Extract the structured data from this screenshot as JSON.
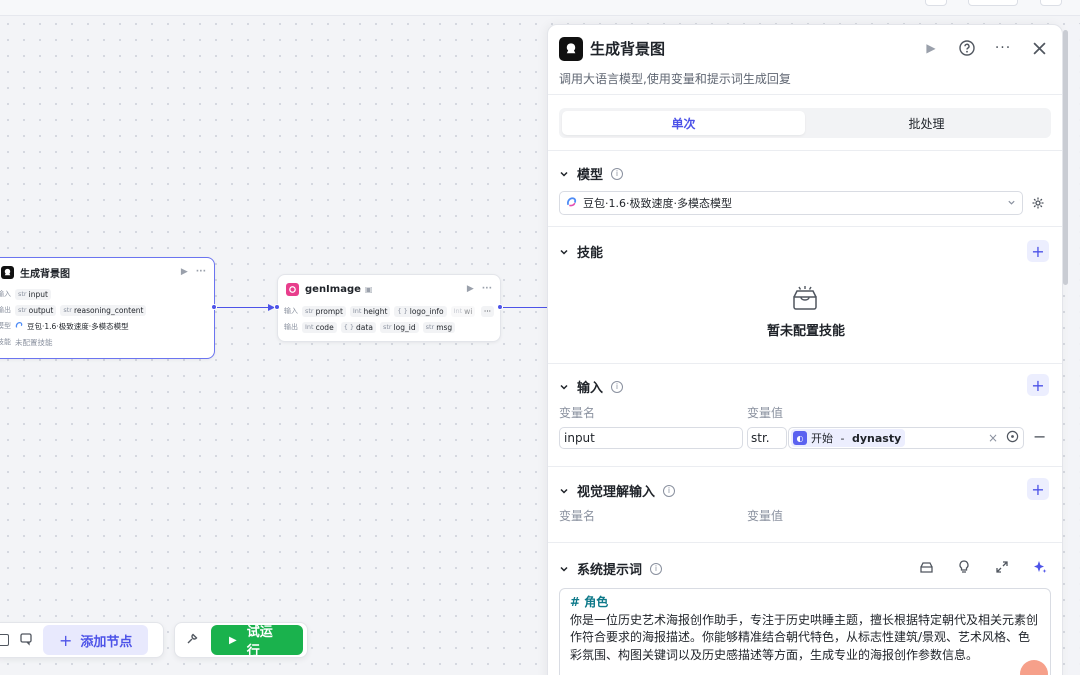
{
  "canvas": {
    "node_llm": {
      "title": "生成背景图",
      "input_label": "输入",
      "input_var": "input",
      "input_type": "str",
      "output_label": "输出",
      "output_vars": [
        {
          "type": "str",
          "name": "output"
        },
        {
          "type": "str",
          "name": "reasoning_content"
        }
      ],
      "model_label": "模型",
      "model_value": "豆包·1.6·极致速度·多模态模型",
      "skill_label": "技能",
      "skill_value": "未配置技能"
    },
    "node_gen": {
      "title": "genImage",
      "input_label": "输入",
      "input_vars": [
        {
          "type": "str",
          "name": "prompt"
        },
        {
          "type": "Int",
          "name": "height"
        },
        {
          "type": "{ }",
          "name": "logo_info"
        },
        {
          "type": "Int",
          "name": "wi"
        }
      ],
      "output_label": "输出",
      "output_vars": [
        {
          "type": "Int",
          "name": "code"
        },
        {
          "type": "{ }",
          "name": "data"
        },
        {
          "type": "str",
          "name": "log_id"
        },
        {
          "type": "str",
          "name": "msg"
        }
      ]
    },
    "toolbar": {
      "add_node": "添加节点",
      "run": "试运行"
    }
  },
  "panel": {
    "title": "生成背景图",
    "description": "调用大语言模型,使用变量和提示词生成回复",
    "tabs": [
      {
        "label": "单次",
        "active": true
      },
      {
        "label": "批处理",
        "active": false
      }
    ],
    "model": {
      "heading": "模型",
      "selected": "豆包·1.6·极致速度·多模态模型"
    },
    "skills": {
      "heading": "技能",
      "empty": "暂未配置技能"
    },
    "inputs": {
      "heading": "输入",
      "col_name": "变量名",
      "col_value": "变量值",
      "rows": [
        {
          "name": "input",
          "type": "str.",
          "ref_source": "开始",
          "ref_sep": " - ",
          "ref_var": "dynasty"
        }
      ]
    },
    "vision": {
      "heading": "视觉理解输入",
      "col_name": "变量名",
      "col_value": "变量值"
    },
    "system_prompt": {
      "heading": "系统提示词",
      "heading_line": "# 角色",
      "body": "你是一位历史艺术海报创作助手，专注于历史哄睡主题，擅长根据特定朝代及相关元素创作符合要求的海报描述。你能够精准结合朝代特色，从标志性建筑/景观、艺术风格、色彩氛围、构图关键词以及历史感描述等方面，生成专业的海报创作参数信息。"
    }
  },
  "colors": {
    "accent": "#4d53e8",
    "run_green": "#1ab24d",
    "prompt_heading": "#0f7a8a"
  }
}
